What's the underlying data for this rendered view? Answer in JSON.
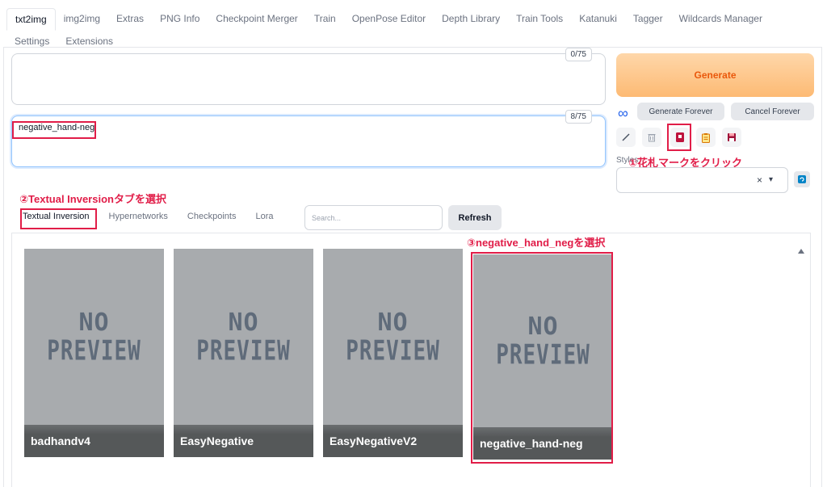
{
  "tabs_row1": [
    "txt2img",
    "img2img",
    "Extras",
    "PNG Info",
    "Checkpoint Merger",
    "Train",
    "OpenPose Editor",
    "Depth Library",
    "Train Tools",
    "Katanuki",
    "Tagger",
    "Wildcards Manager"
  ],
  "tabs_row2": [
    "Settings",
    "Extensions"
  ],
  "active_tab": "txt2img",
  "prompt": {
    "value": "",
    "counter": "0/75"
  },
  "negative_prompt": {
    "value": "negative_hand-neg",
    "counter": "8/75"
  },
  "generate": {
    "label": "Generate",
    "forever_label": "Generate Forever",
    "cancel_label": "Cancel Forever"
  },
  "styles": {
    "label": "Styles",
    "clear_symbol": "×",
    "dropdown_symbol": "▾"
  },
  "networks": {
    "tabs": [
      "Textual Inversion",
      "Hypernetworks",
      "Checkpoints",
      "Lora"
    ],
    "active": "Textual Inversion",
    "search_placeholder": "Search...",
    "refresh_label": "Refresh",
    "cards": [
      {
        "name": "badhandv4",
        "preview_top": "NO",
        "preview_bottom": "PREVIEW"
      },
      {
        "name": "EasyNegative",
        "preview_top": "NO",
        "preview_bottom": "PREVIEW"
      },
      {
        "name": "EasyNegativeV2",
        "preview_top": "NO",
        "preview_bottom": "PREVIEW"
      },
      {
        "name": "negative_hand-neg",
        "preview_top": "NO",
        "preview_bottom": "PREVIEW"
      }
    ]
  },
  "annotations": {
    "step1": "①花札マークをクリック",
    "step2": "②Textual Inversionタブを選択",
    "step3": "③negative_hand_negを選択"
  },
  "colors": {
    "accent_red": "#e11d48",
    "generate_orange": "#ea580c",
    "infinity_blue": "#2563eb"
  }
}
